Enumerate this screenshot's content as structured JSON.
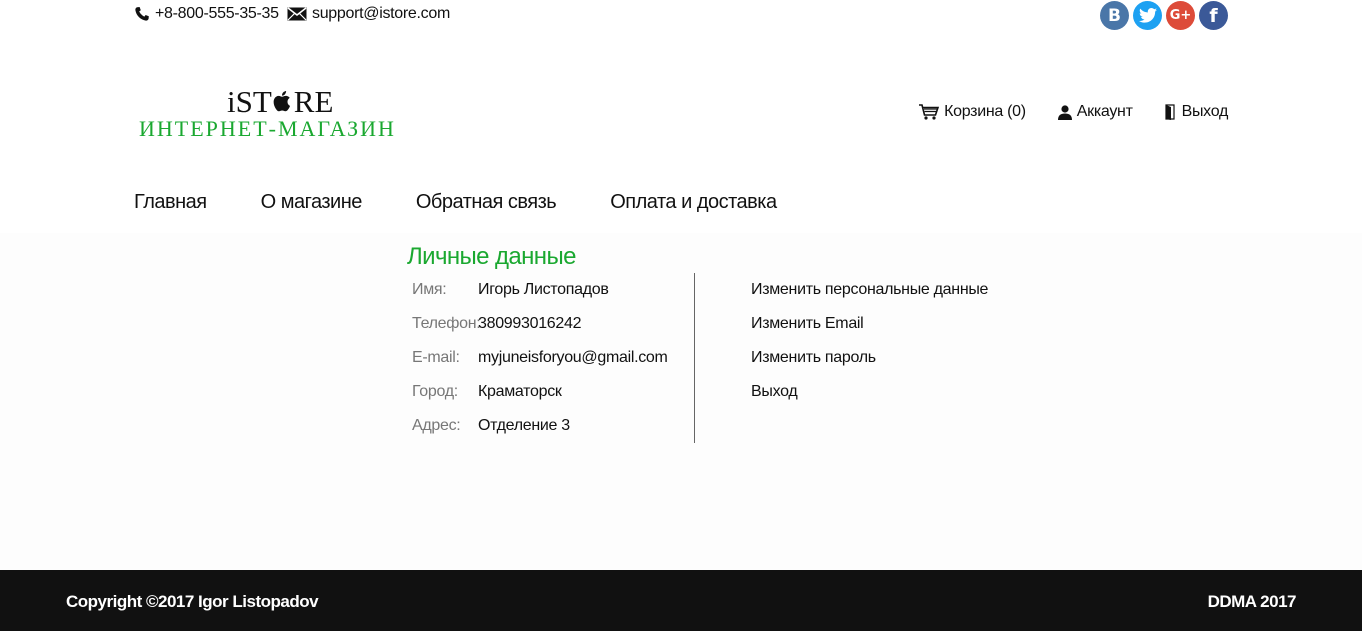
{
  "topbar": {
    "phone": "+8-800-555-35-35",
    "email": "support@istore.com",
    "social": [
      {
        "icon": "vk-icon",
        "glyph": "B",
        "color": "#4a76a8"
      },
      {
        "icon": "twitter-icon",
        "glyph": "t",
        "color": "#1da1f2"
      },
      {
        "icon": "google-plus-icon",
        "glyph": "G+",
        "color": "#dd4b39"
      },
      {
        "icon": "facebook-icon",
        "glyph": "f",
        "color": "#3b5998"
      }
    ]
  },
  "logo": {
    "brand_prefix": "iST",
    "brand_suffix": "RE",
    "subtitle": "ИНТЕРНЕТ-МАГАЗИН"
  },
  "usermenu": {
    "cart": "Корзина (0)",
    "account": "Аккаунт",
    "logout": "Выход"
  },
  "nav": [
    "Главная",
    "О магазине",
    "Обратная связь",
    "Оплата и доставка"
  ],
  "profile": {
    "title": "Личные данные",
    "fields": [
      {
        "label": "Имя:",
        "value": "Игорь Листопадов"
      },
      {
        "label": "Телефон:",
        "value": "380993016242"
      },
      {
        "label": "E-mail:",
        "value": "myjuneisforyou@gmail.com"
      },
      {
        "label": "Город:",
        "value": "Краматорск"
      },
      {
        "label": "Адрес:",
        "value": "Отделение 3"
      }
    ],
    "actions": [
      "Изменить персональные данные",
      "Изменить Email",
      "Изменить пароль",
      "Выход"
    ]
  },
  "footer": {
    "copyright": "Copyright ©2017 Igor Listopadov",
    "right": "DDMA 2017"
  },
  "colors": {
    "accent": "#1aa830",
    "footer_bg": "#111111"
  }
}
